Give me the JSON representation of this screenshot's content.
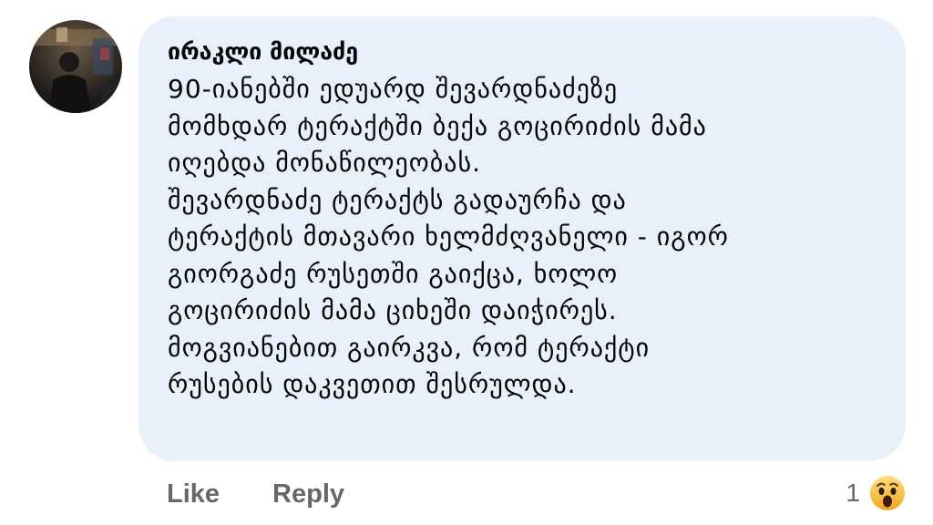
{
  "comment": {
    "author": "ირაკლი მილაძე",
    "lines": [
      "90-იანებში ედუარდ შევარდნაძეზე",
      "მომხდარ ტერაქტში ბექა გოცირიძის მამა",
      "იღებდა მონაწილეობას.",
      "შევარდნაძე ტერაქტს გადაურჩა და",
      "ტერაქტის მთავარი ხელმძღვანელი - იგორ",
      "გიორგაძე რუსეთში გაიქცა, ხოლო",
      "გოცირიძის მამა ციხეში დაიჭირეს.",
      "მოგვიანებით გაირკვა, რომ ტერაქტი",
      "რუსების დაკვეთით შესრულდა."
    ]
  },
  "actions": {
    "like_label": "Like",
    "reply_label": "Reply"
  },
  "reactions": {
    "count": "1",
    "icon": "wow-emoji-icon"
  },
  "colors": {
    "bubble": "#e8f0fb",
    "text": "#050505",
    "secondary_text": "#65676b",
    "wow_yellow": "#f7b125"
  }
}
